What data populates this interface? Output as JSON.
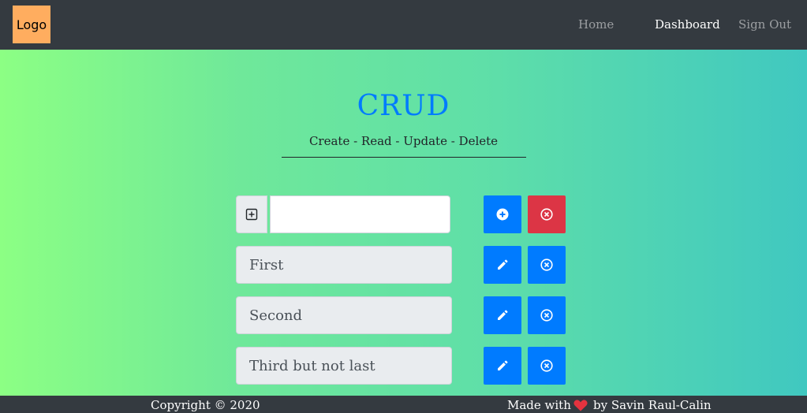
{
  "navbar": {
    "logo": "Logo",
    "links": [
      "Home",
      "Dashboard",
      "Sign Out"
    ],
    "active": "Dashboard"
  },
  "header": {
    "title": "CRUD",
    "subtitle": "Create - Read - Update - Delete"
  },
  "add_row": {
    "input_value": "",
    "add_icon": "plus-square-icon",
    "submit_icon": "plus-circle-icon",
    "clear_icon": "x-circle-icon"
  },
  "items": [
    {
      "label": "First"
    },
    {
      "label": "Second"
    },
    {
      "label": "Third but not last"
    }
  ],
  "footer": {
    "copyright": "Copyright © 2020",
    "made_with": "Made with",
    "author": "by Savin Raul-Calin"
  },
  "colors": {
    "navbar": "#343a40",
    "primary": "#007bff",
    "danger": "#dc3545",
    "logo_bg": "#ffad5f",
    "heart": "#e4333f"
  }
}
